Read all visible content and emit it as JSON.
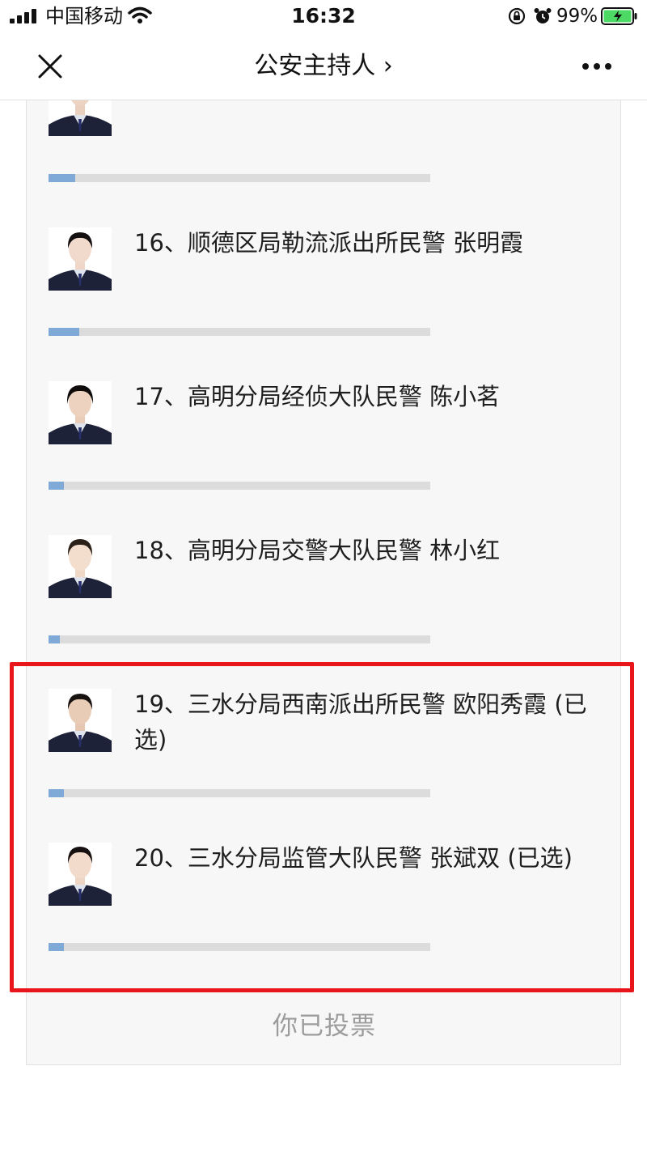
{
  "status_bar": {
    "carrier": "中国移动",
    "time": "16:32",
    "battery_percent": "99%",
    "icons": [
      "signal-icon",
      "wifi-icon",
      "rotation-lock-icon",
      "alarm-icon",
      "battery-charging-icon"
    ]
  },
  "nav": {
    "title": "公安主持人 ›",
    "close_icon": "close-icon",
    "more_icon": "more-icon"
  },
  "candidates": [
    {
      "label": "",
      "vote_share": 0.07
    },
    {
      "label": "16、顺德区局勒流派出所民警 张明霞",
      "vote_share": 0.08
    },
    {
      "label": "17、高明分局经侦大队民警 陈小茗",
      "vote_share": 0.04
    },
    {
      "label": "18、高明分局交警大队民警 林小红",
      "vote_share": 0.03
    },
    {
      "label": "19、三水分局西南派出所民警 欧阳秀霞 (已选)",
      "vote_share": 0.04
    },
    {
      "label": "20、三水分局监管大队民警 张斌双 (已选)",
      "vote_share": 0.04
    }
  ],
  "vote_status": "你已投票",
  "colors": {
    "highlight": "#e8161b",
    "bar_fill": "#7fa9d6",
    "bar_track": "#dcdcdc"
  }
}
